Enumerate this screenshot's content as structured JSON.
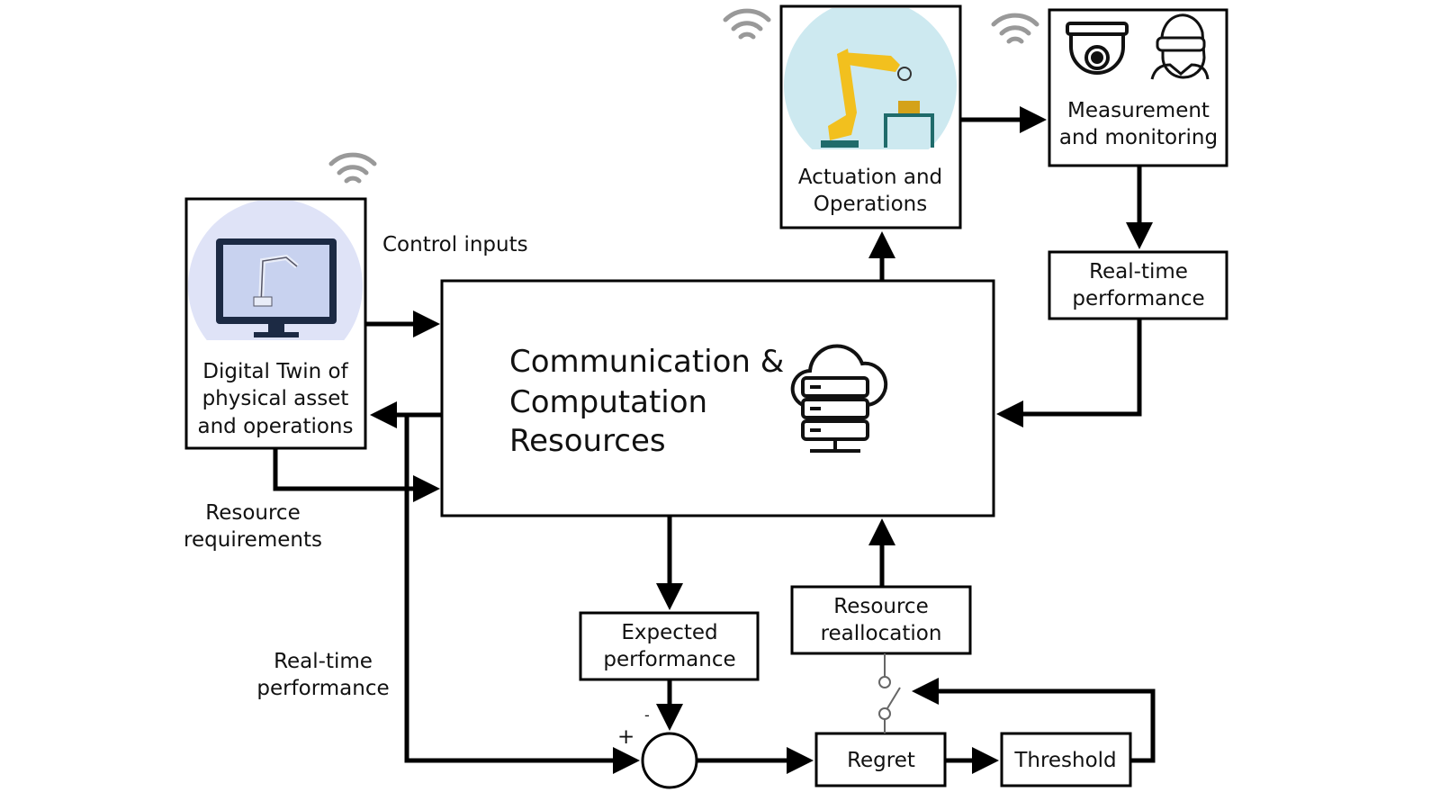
{
  "nodes": {
    "digital_twin": [
      "Digital Twin of",
      "physical asset",
      "and operations"
    ],
    "main": [
      "Communication &",
      "Computation",
      "Resources"
    ],
    "actuation": [
      "Actuation and",
      "Operations"
    ],
    "measurement": [
      "Measurement",
      "and monitoring"
    ],
    "realtime_box": [
      "Real-time",
      "performance"
    ],
    "expected": [
      "Expected",
      "performance"
    ],
    "reallocation": [
      "Resource",
      "reallocation"
    ],
    "regret": "Regret",
    "threshold": "Threshold"
  },
  "labels": {
    "control_inputs": "Control inputs",
    "resource_requirements": [
      "Resource",
      "requirements"
    ],
    "realtime_left": [
      "Real-time",
      "performance"
    ],
    "plus": "+",
    "minus": "-"
  },
  "icons": [
    "wifi-icon",
    "robot-arm-icon",
    "monitor-icon",
    "cloud-server-icon",
    "dome-camera-icon",
    "vr-headset-person-icon",
    "switch-icon",
    "summing-junction"
  ],
  "colors": {
    "dt_bg": "#dfe3f7",
    "act_bg": "#cde9f0",
    "robot": "#f2c01e",
    "table": "#1f6b6b"
  }
}
